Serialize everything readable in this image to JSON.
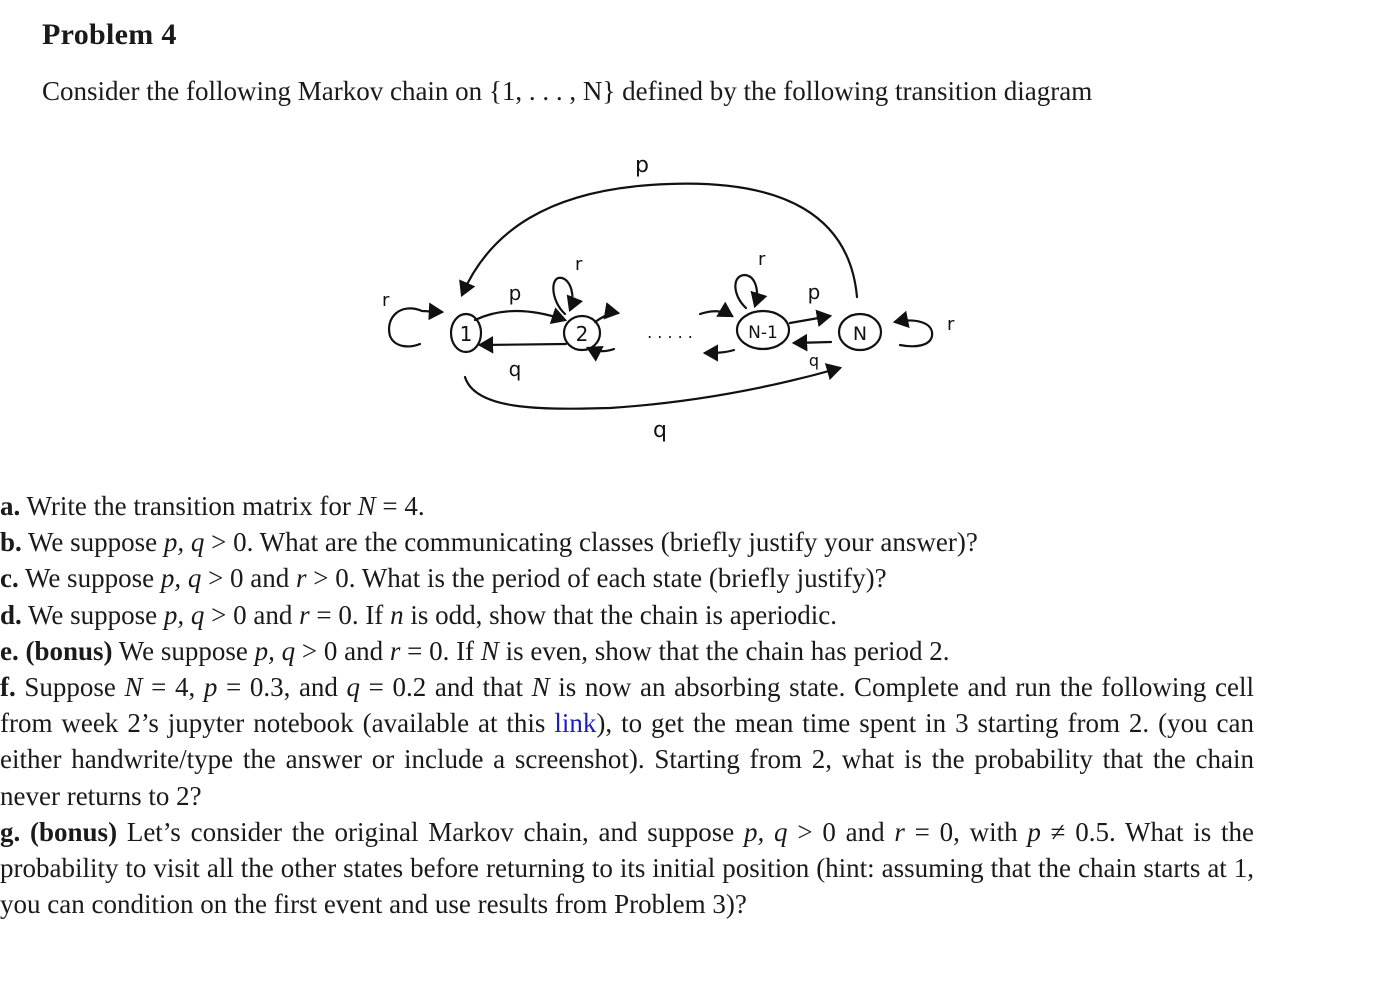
{
  "document": {
    "title": "Problem 4",
    "intro": "Consider the following Markov chain on {1, . . . , N} defined by the following transition diagram"
  },
  "diagram": {
    "nodes": [
      "1",
      "2",
      "N-1",
      "N"
    ],
    "labels": {
      "top_arc": "p",
      "bottom_arc": "q",
      "p_1_2": "p",
      "q_2_1": "q",
      "p_N1_N": "p",
      "q_N_N1": "q",
      "self_1": "r",
      "self_2": "r",
      "self_N1": "r",
      "self_N": "r"
    },
    "ellipsis": ". . . . ."
  },
  "questions": [
    {
      "label": "a.",
      "bonus": "",
      "parts": [
        {
          "t": "Write the transition matrix for "
        },
        {
          "m": "N"
        },
        {
          "t": " = 4."
        }
      ]
    },
    {
      "label": "b.",
      "bonus": "",
      "parts": [
        {
          "t": "We suppose "
        },
        {
          "m": "p, q"
        },
        {
          "t": " > 0. What are the communicating classes (briefly justify your answer)?"
        }
      ]
    },
    {
      "label": "c.",
      "bonus": "",
      "parts": [
        {
          "t": "We suppose "
        },
        {
          "m": "p, q"
        },
        {
          "t": " > 0 and "
        },
        {
          "m": "r"
        },
        {
          "t": " > 0. What is the period of each state (briefly justify)?"
        }
      ]
    },
    {
      "label": "d.",
      "bonus": "",
      "parts": [
        {
          "t": "We suppose "
        },
        {
          "m": "p, q"
        },
        {
          "t": " > 0 and "
        },
        {
          "m": "r"
        },
        {
          "t": " = 0. If "
        },
        {
          "m": "n"
        },
        {
          "t": " is odd, show that the chain is aperiodic."
        }
      ]
    },
    {
      "label": "e.",
      "bonus": "(bonus)",
      "parts": [
        {
          "t": "We suppose "
        },
        {
          "m": "p, q"
        },
        {
          "t": " > 0 and "
        },
        {
          "m": "r"
        },
        {
          "t": " = 0. If "
        },
        {
          "m": "N"
        },
        {
          "t": " is even, show that the chain has period 2."
        }
      ]
    },
    {
      "label": "f.",
      "bonus": "",
      "parts": [
        {
          "t": "Suppose "
        },
        {
          "m": "N"
        },
        {
          "t": " = 4, "
        },
        {
          "m": "p"
        },
        {
          "t": " = 0.3, and "
        },
        {
          "m": "q"
        },
        {
          "t": " = 0.2 and that "
        },
        {
          "m": "N"
        },
        {
          "t": " is now an absorbing state.  Complete and run the following cell from week 2’s jupyter notebook (available at this "
        },
        {
          "link": "link"
        },
        {
          "t": "), to get the mean time spent in 3 starting from 2.  (you can either handwrite/type the answer or include a screenshot). Starting from 2, what is the probability that the chain never returns to 2?"
        }
      ]
    },
    {
      "label": "g.",
      "bonus": "(bonus)",
      "parts": [
        {
          "t": "Let’s consider the original Markov chain, and suppose "
        },
        {
          "m": "p, q"
        },
        {
          "t": " > 0 and "
        },
        {
          "m": "r"
        },
        {
          "t": " = 0, with "
        },
        {
          "m": "p"
        },
        {
          "t": " ≠ 0.5. What is the probability to visit all the other states before returning to its initial position (hint: assuming that the chain starts at 1, you can condition on the first event and use results from Problem 3)?"
        }
      ]
    }
  ],
  "colors": {
    "link": "#1a1acc",
    "text": "#1a1a1a"
  }
}
